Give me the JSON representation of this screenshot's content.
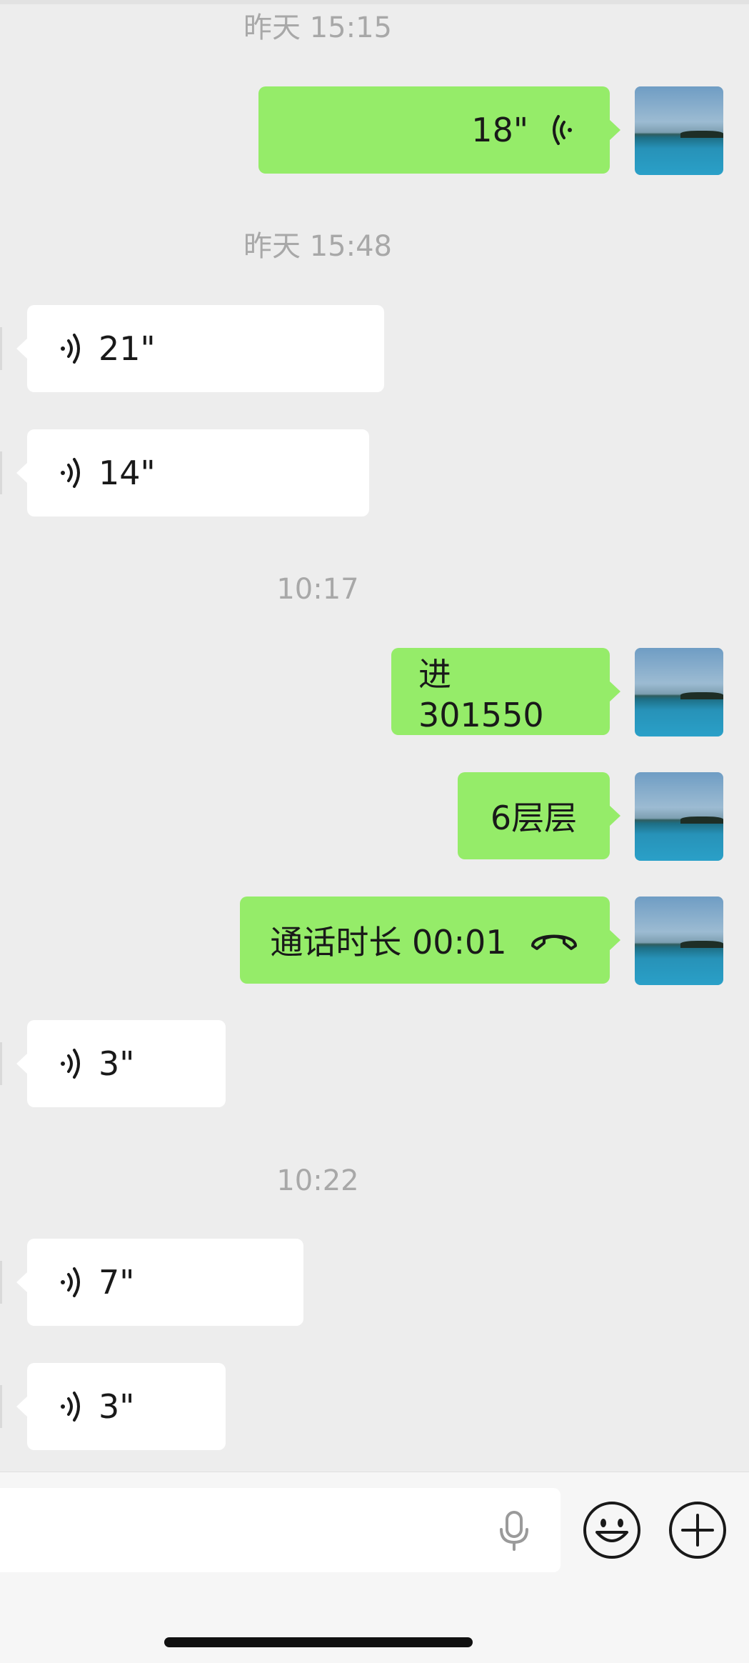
{
  "chat": {
    "timestamps": [
      "昨天 15:15",
      "昨天 15:48",
      "10:17",
      "10:22"
    ],
    "messages": {
      "m1": {
        "direction": "out",
        "type": "voice",
        "duration": "18\""
      },
      "m2": {
        "direction": "in",
        "type": "voice",
        "duration": "21\""
      },
      "m3": {
        "direction": "in",
        "type": "voice",
        "duration": "14\""
      },
      "m4": {
        "direction": "out",
        "type": "text",
        "text": "进 301550"
      },
      "m5": {
        "direction": "out",
        "type": "text",
        "text": "6层层"
      },
      "m6": {
        "direction": "out",
        "type": "call",
        "text": "通话时长 00:01",
        "icon": "phone-hangup-icon"
      },
      "m7": {
        "direction": "in",
        "type": "voice",
        "duration": "3\""
      },
      "m8": {
        "direction": "in",
        "type": "voice",
        "duration": "7\""
      },
      "m9": {
        "direction": "in",
        "type": "voice",
        "duration": "3\""
      }
    }
  },
  "input_bar": {
    "icons": [
      "microphone-icon",
      "emoji-icon",
      "plus-icon"
    ]
  },
  "colors": {
    "background": "#ededed",
    "outgoing_bubble": "#95ec69",
    "incoming_bubble": "#ffffff",
    "timestamp_text": "#a8a8a8"
  }
}
